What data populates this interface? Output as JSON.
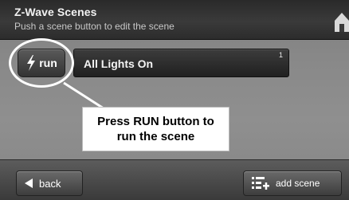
{
  "header": {
    "title": "Z-Wave Scenes",
    "subtitle": "Push a scene button to edit the scene"
  },
  "scene": {
    "run_label": "run",
    "name": "All Lights On",
    "number": "1"
  },
  "callout": {
    "text": "Press RUN button to\nrun the scene"
  },
  "footer": {
    "back_label": "back",
    "add_scene_label": "add scene"
  },
  "icons": {
    "run": "lightning-bolt-icon",
    "back": "left-arrow-icon",
    "add_scene": "list-plus-icon",
    "home": "home-icon"
  }
}
